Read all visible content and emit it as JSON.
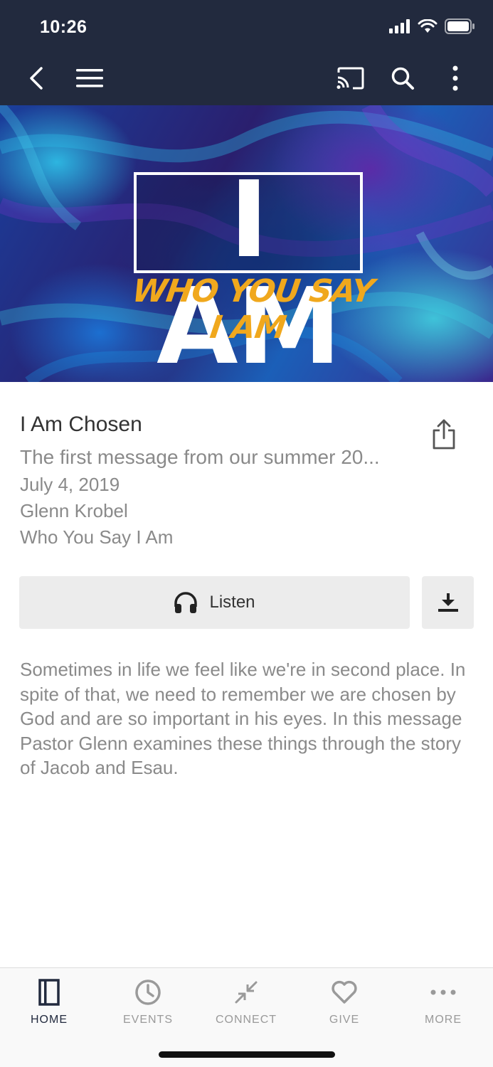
{
  "status_bar": {
    "time": "10:26"
  },
  "hero": {
    "logo_main": "I AM",
    "logo_sub": "WHO YOU SAY I AM"
  },
  "sermon": {
    "title": "I Am Chosen",
    "subtitle": "The first message from our summer 20...",
    "date": "July 4, 2019",
    "speaker": "Glenn Krobel",
    "series": "Who You Say I Am",
    "description": "Sometimes in life we feel like we're in second place. In spite of that, we need to remember we are chosen by God and are so important in his eyes. In this message Pastor Glenn examines these things through the story of Jacob and Esau."
  },
  "actions": {
    "listen_label": "Listen"
  },
  "tabs": [
    {
      "label": "HOME",
      "icon": "home-icon",
      "active": true
    },
    {
      "label": "EVENTS",
      "icon": "clock-icon",
      "active": false
    },
    {
      "label": "CONNECT",
      "icon": "connect-icon",
      "active": false
    },
    {
      "label": "GIVE",
      "icon": "heart-icon",
      "active": false
    },
    {
      "label": "MORE",
      "icon": "more-dots-icon",
      "active": false
    }
  ],
  "colors": {
    "header_bg": "#222a3e",
    "active_tab": "#222a3e",
    "inactive_tab": "#9a9a9a",
    "logo_accent": "#f0a81d"
  }
}
